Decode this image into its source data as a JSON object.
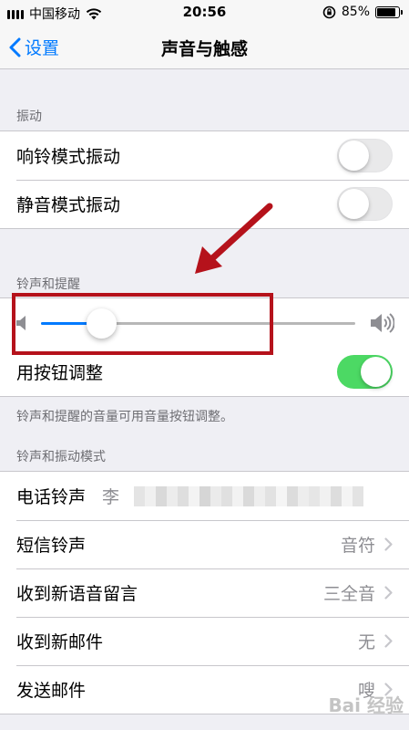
{
  "status_bar": {
    "carrier": "中国移动",
    "time": "20:56",
    "battery": "85%"
  },
  "nav": {
    "back_label": "设置",
    "title": "声音与触感"
  },
  "vibration": {
    "header": "振动",
    "rows": [
      {
        "label": "响铃模式振动",
        "on": false
      },
      {
        "label": "静音模式振动",
        "on": false
      }
    ]
  },
  "ringer": {
    "header": "铃声和提醒",
    "volume_level": 0.19,
    "change_with_buttons_label": "用按钮调整",
    "change_with_buttons_on": true,
    "footer": "铃声和提醒的音量可用音量按钮调整。"
  },
  "patterns": {
    "header": "铃声和振动模式",
    "rows": [
      {
        "label": "电话铃声",
        "value": "李"
      },
      {
        "label": "短信铃声",
        "value": "音符"
      },
      {
        "label": "收到新语音留言",
        "value": "三全音"
      },
      {
        "label": "收到新邮件",
        "value": "无"
      },
      {
        "label": "发送邮件",
        "value": "嗖"
      }
    ]
  },
  "watermark": "Bai 经验",
  "colors": {
    "accent": "#007aff",
    "switch_on": "#4cd964",
    "annotation": "#b5121b"
  },
  "icons": [
    "signal-icon",
    "wifi-icon",
    "orientation-lock-icon",
    "battery-icon",
    "back-chevron-icon",
    "volume-low-icon",
    "volume-high-icon",
    "chevron-right-icon",
    "annotation-arrow"
  ]
}
